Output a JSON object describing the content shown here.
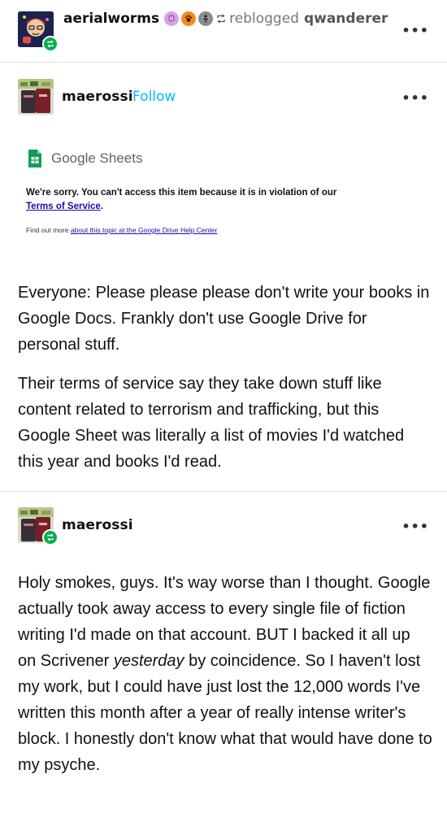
{
  "reblog": {
    "username": "aerialworms",
    "action": "reblogged",
    "source": "qwanderer",
    "more_label": "•••"
  },
  "post1": {
    "username": "maerossi",
    "follow_label": "Follow",
    "more_label": "•••",
    "sheets_brand": "Google Sheets",
    "error_message": "We're sorry. You can't access this item because it is in violation of our",
    "tos_link": "Terms of Service",
    "tos_period": ".",
    "find_out_prefix": "Find out more ",
    "find_out_link": "about this topic at the Google Drive Help Center",
    "para1": "Everyone: Please please please don't write your books in Google Docs. Frankly don't use Google Drive for personal stuff.",
    "para2": "Their terms of service say they take down stuff like content related to terrorism and trafficking, but this Google Sheet was literally a list of movies I'd watched this year and books I'd read."
  },
  "post2": {
    "username": "maerossi",
    "more_label": "•••",
    "text_a": "Holy smokes, guys. It's way worse than I thought. Google actually took away access to every single file of fiction writing I'd made on that account. BUT I backed it all up on Scrivener ",
    "text_italic": "yesterday",
    "text_b": " by coincidence. So I haven't lost my work, but I could have just lost the 12,000 words I've written this month after a year of really intense writer's block. I honestly don't know what that would have done to my psyche."
  },
  "colors": {
    "follow": "#00b8ff",
    "reblog_badge": "#00b24a",
    "sheets_green": "#0f9d58",
    "link_blue": "#1a0dab"
  }
}
